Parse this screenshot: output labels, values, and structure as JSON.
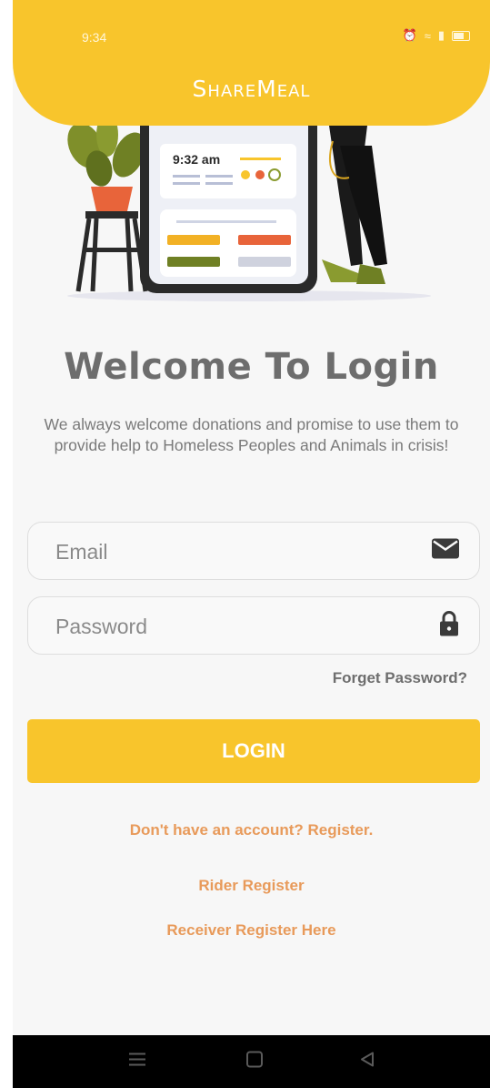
{
  "status": {
    "time": "9:34"
  },
  "header": {
    "title": "ShareMeal"
  },
  "illustration": {
    "phone_time": "9:32 am"
  },
  "welcome": {
    "title": "Welcome To Login",
    "subtitle": "We always welcome donations and promise to use them to provide help to Homeless Peoples and Animals in crisis!"
  },
  "form": {
    "email": {
      "placeholder": "Email",
      "value": "",
      "icon": "mail-icon"
    },
    "password": {
      "placeholder": "Password",
      "value": "",
      "icon": "lock-icon"
    },
    "forgot_label": "Forget Password?",
    "login_label": "LOGIN"
  },
  "links": {
    "register": "Don't have an account? Register.",
    "rider": "Rider Register",
    "receiver": "Receiver Register Here"
  },
  "colors": {
    "primary": "#f8c52c",
    "link": "#e89a5a",
    "title_text": "#6d6d6d"
  },
  "navbar": {
    "icons": [
      "menu-icon",
      "home-square-icon",
      "back-triangle-icon"
    ]
  }
}
